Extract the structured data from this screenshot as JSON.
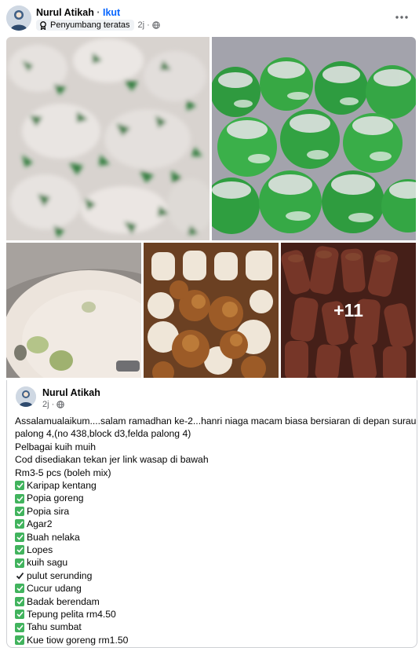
{
  "header": {
    "author": "Nurul Atikah",
    "separator": "·",
    "follow_label": "Ikut",
    "badge_label": "Penyumbang teratas",
    "time": "2j",
    "dot": "·"
  },
  "gallery": {
    "more_count": "+11"
  },
  "shared_post": {
    "author": "Nurul Atikah",
    "time": "2j",
    "dot": "·",
    "lines": [
      "Assalamualaikum....salam ramadhan ke-2...hanri niaga macam biasa bersiaran di depan surau",
      "palong 4,(no 438,block d3,felda palong 4)",
      "Pelbagai kuih muih",
      "Cod disediakan tekan jer link wasap di bawah",
      "Rm3-5 pcs (boleh mix)"
    ],
    "items": [
      {
        "label": "Karipap kentang",
        "icon": "green-check"
      },
      {
        "label": "Popia goreng",
        "icon": "green-check"
      },
      {
        "label": "Popia sira",
        "icon": "green-check"
      },
      {
        "label": "Agar2",
        "icon": "green-check"
      },
      {
        "label": "Buah nelaka",
        "icon": "green-check"
      },
      {
        "label": "Lopes",
        "icon": "green-check"
      },
      {
        "label": "kuih sagu",
        "icon": "green-check"
      },
      {
        "label": "pulut serunding",
        "icon": "check-mark"
      },
      {
        "label": "Cucur udang",
        "icon": "green-check"
      },
      {
        "label": "Badak berendam",
        "icon": "green-check"
      },
      {
        "label": "Tepung pelita rm4.50",
        "icon": "green-check"
      },
      {
        "label": "Tahu sumbat",
        "icon": "green-check"
      },
      {
        "label": "Kue tiow goreng rm1.50",
        "icon": "green-check"
      }
    ]
  },
  "colors": {
    "accent": "#0866ff",
    "check_green": "#41b35d",
    "secondary_text": "#65676b"
  }
}
